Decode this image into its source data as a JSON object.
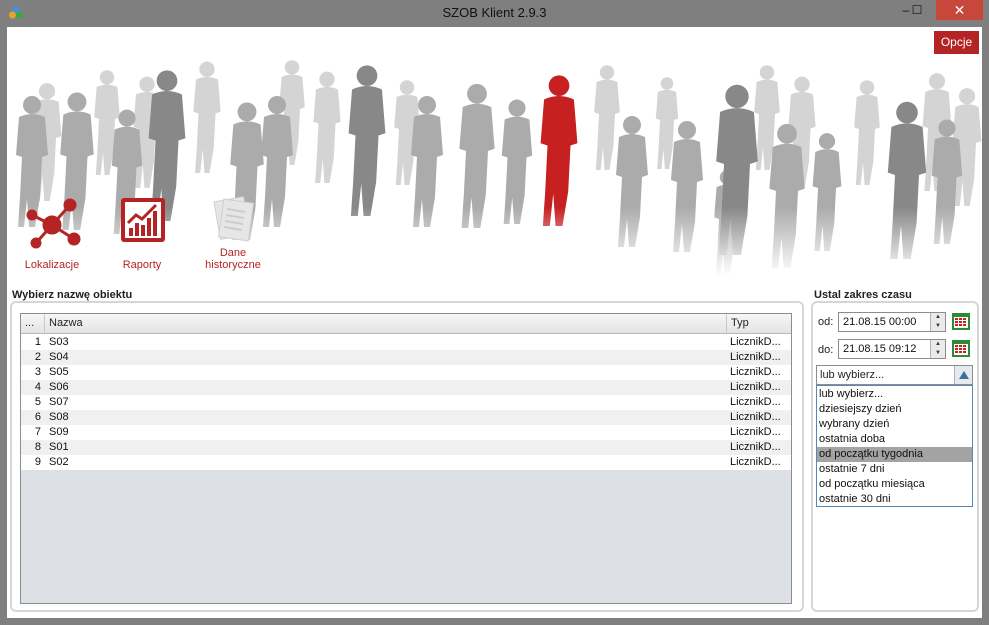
{
  "window": {
    "title": "SZOB Klient  2.9.3",
    "min_glyph": "–",
    "max_glyph": "☐",
    "close_glyph": "✕"
  },
  "header": {
    "options_label": "Opcje"
  },
  "toolbar": {
    "items": [
      {
        "label": "Lokalizacje",
        "icon": "network-icon"
      },
      {
        "label": "Raporty",
        "icon": "report-chart-icon"
      },
      {
        "label": "Dane historyczne",
        "icon": "documents-icon"
      }
    ]
  },
  "objects": {
    "section_title": "Wybierz nazwę obiektu",
    "columns": [
      "...",
      "Nazwa",
      "Typ"
    ],
    "rows": [
      {
        "num": "1",
        "name": "S03",
        "typ": "LicznikD..."
      },
      {
        "num": "2",
        "name": "S04",
        "typ": "LicznikD..."
      },
      {
        "num": "3",
        "name": "S05",
        "typ": "LicznikD..."
      },
      {
        "num": "4",
        "name": "S06",
        "typ": "LicznikD..."
      },
      {
        "num": "5",
        "name": "S07",
        "typ": "LicznikD..."
      },
      {
        "num": "6",
        "name": "S08",
        "typ": "LicznikD..."
      },
      {
        "num": "7",
        "name": "S09",
        "typ": "LicznikD..."
      },
      {
        "num": "8",
        "name": "S01",
        "typ": "LicznikD..."
      },
      {
        "num": "9",
        "name": "S02",
        "typ": "LicznikD..."
      }
    ]
  },
  "time_range": {
    "section_title": "Ustal zakres czasu",
    "from_label": "od:",
    "from_value": "21.08.15 00:00",
    "to_label": "do:",
    "to_value": "21.08.15 09:12",
    "combo_value": "lub wybierz...",
    "options": [
      "lub wybierz...",
      "dziesiejszy dzień",
      "wybrany dzień",
      "ostatnia doba",
      "od początku tygodnia",
      "ostatnie 7 dni",
      "od początku miesiąca",
      "ostatnie 30 dni"
    ],
    "selected_option": "od początku tygodnia"
  },
  "colors": {
    "accent": "#b52424",
    "silhouette_highlight": "#c62020",
    "silhouette_gray": "#9a9a9a"
  }
}
